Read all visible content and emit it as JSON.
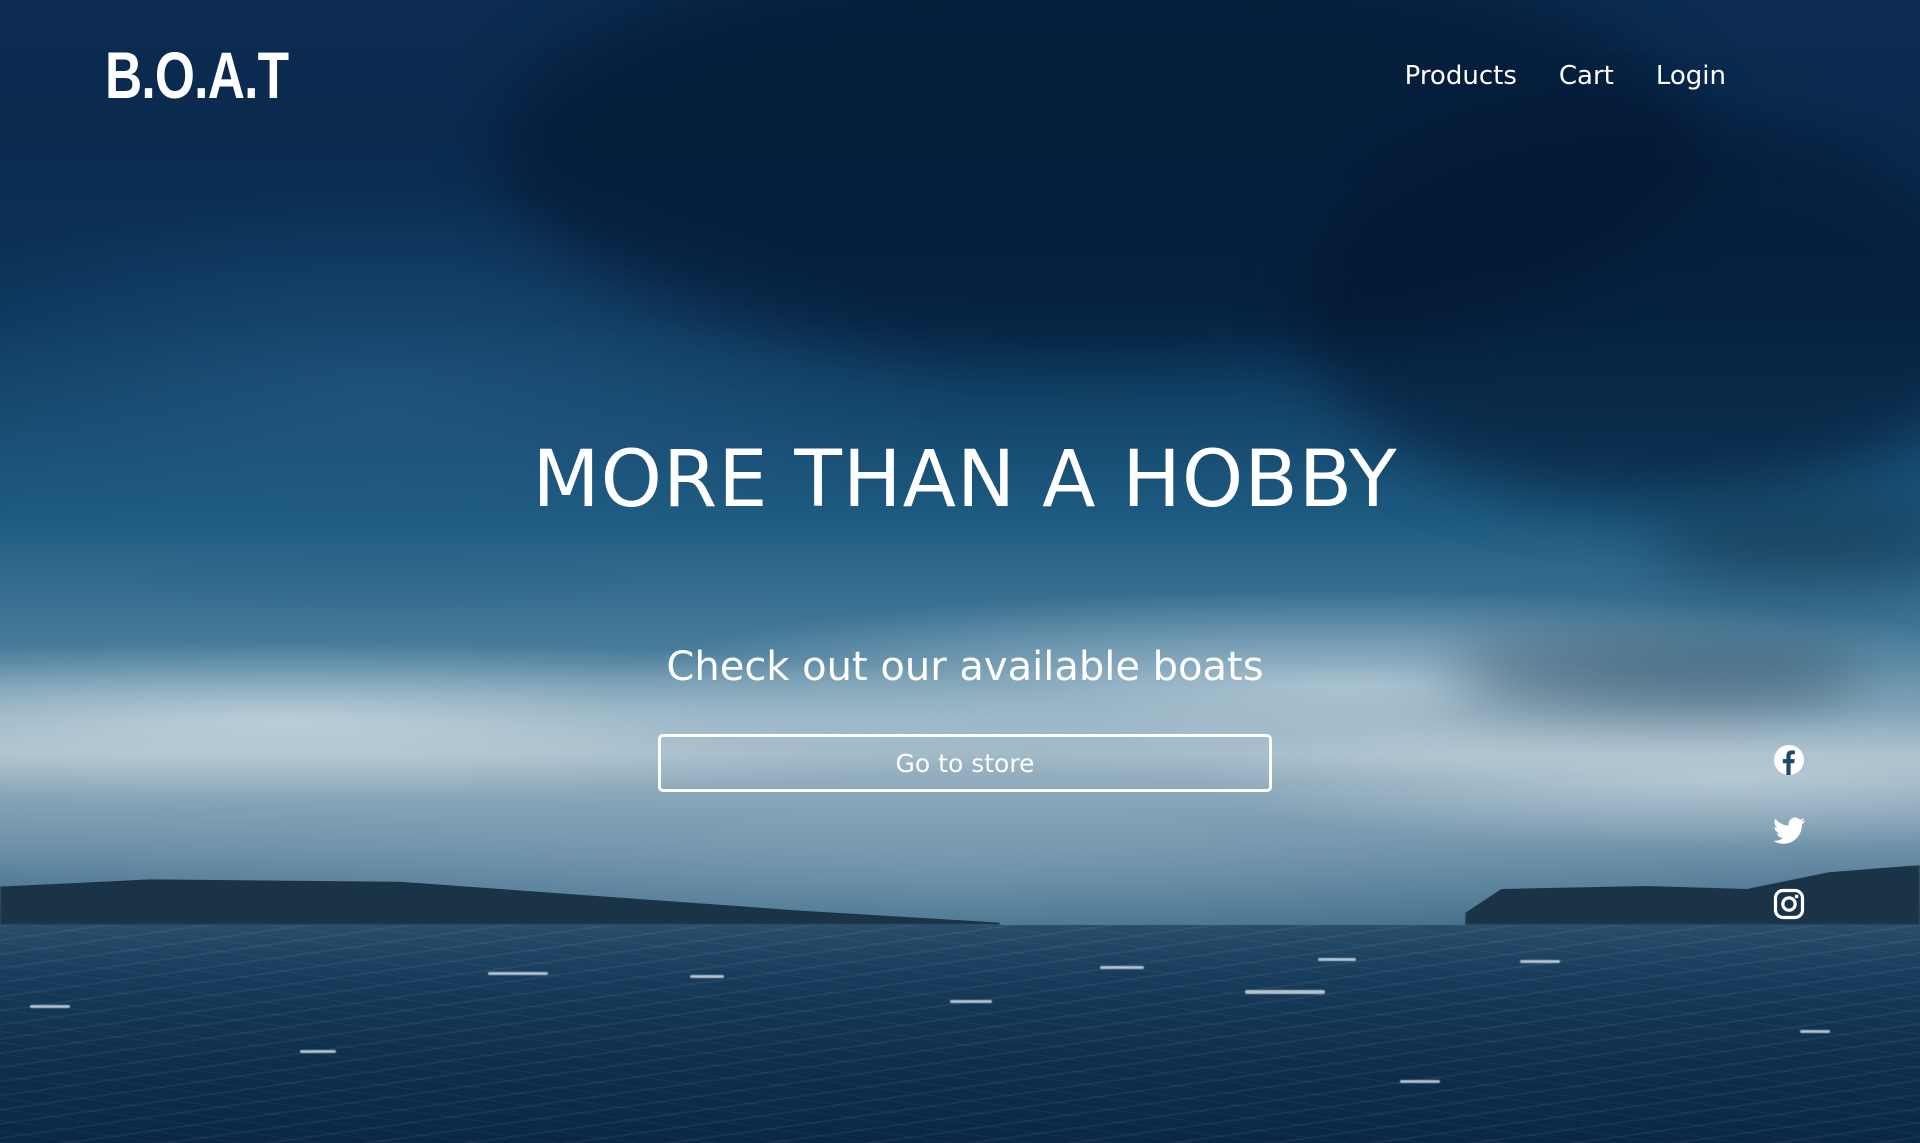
{
  "header": {
    "logo": "B.O.A.T",
    "nav": [
      {
        "label": "Products"
      },
      {
        "label": "Cart"
      },
      {
        "label": "Login"
      }
    ]
  },
  "hero": {
    "headline": "MORE THAN A HOBBY",
    "subheadline": "Check out our available boats",
    "button_label": "Go to store"
  },
  "social": [
    {
      "icon": "facebook-icon"
    },
    {
      "icon": "twitter-icon"
    },
    {
      "icon": "instagram-icon"
    }
  ],
  "colors": {
    "text": "#ffffff",
    "sky_dark": "#0a2a4e",
    "sea": "#0f2f4e"
  }
}
